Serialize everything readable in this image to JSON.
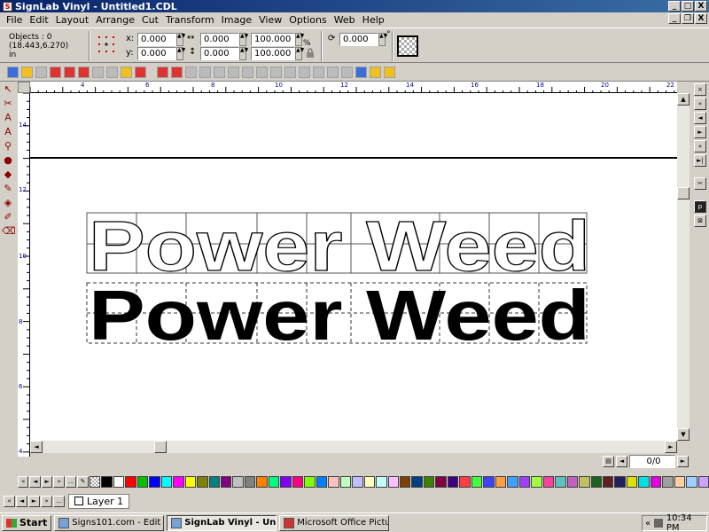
{
  "window": {
    "title": "SignLab Vinyl - Untitled1.CDL",
    "minimize": "_",
    "maximize": "□",
    "close": "X"
  },
  "menu": [
    "File",
    "Edit",
    "Layout",
    "Arrange",
    "Cut",
    "Transform",
    "Image",
    "View",
    "Options",
    "Web",
    "Help"
  ],
  "mdi_controls": {
    "minimize": "_",
    "restore": "❐",
    "close": "X"
  },
  "properties": {
    "objects_label": "Objects : 0",
    "cursor_pos": "(18.443,6.270)",
    "units": "in",
    "x_label": "x:",
    "y_label": "y:",
    "x_value": "0.000",
    "y_value": "0.000",
    "width_value": "0.000",
    "height_value": "0.000",
    "scale_x": "100.000",
    "scale_y": "100.000",
    "percent": "%",
    "rotation_value": "0.000",
    "degree": "°"
  },
  "ruler": {
    "top_labels": [
      "4",
      "6",
      "8",
      "10",
      "12",
      "14",
      "16",
      "18",
      "20",
      "22"
    ],
    "left_labels": [
      "14",
      "12",
      "10",
      "8",
      "6",
      "4"
    ]
  },
  "canvas": {
    "outline_text": "Power Weed",
    "filled_text": "Power Weed"
  },
  "page_nav": {
    "page_value": "0/0"
  },
  "palette": {
    "colors": [
      "#000000",
      "#ffffff",
      "#ff0000",
      "#00c000",
      "#0000ff",
      "#00ffff",
      "#ff00ff",
      "#ffff00",
      "#808000",
      "#008080",
      "#800080",
      "#c0c0c0",
      "#808080",
      "#ff8000",
      "#00ff80",
      "#8000ff",
      "#ff0080",
      "#80ff00",
      "#0080ff",
      "#ffc0c0",
      "#c0ffc0",
      "#c0c0ff",
      "#ffffc0",
      "#c0ffff",
      "#ffc0ff",
      "#804000",
      "#004080",
      "#408000",
      "#800040",
      "#400080",
      "#ff4040",
      "#40ff40",
      "#4040ff",
      "#ffa040",
      "#40a0ff",
      "#a040ff",
      "#a0ff40",
      "#ff40a0",
      "#60c0c0",
      "#c060c0",
      "#c0c060",
      "#206020",
      "#602020",
      "#202060",
      "#e0e000",
      "#00e0e0",
      "#e000e0",
      "#a0a0a0",
      "#ffd0a0",
      "#a0d0ff",
      "#d0a0ff"
    ]
  },
  "layers": {
    "active": "Layer 1"
  },
  "taskbar": {
    "start": "Start",
    "items": [
      "Signs101.com - Edit Post...",
      "SignLab Vinyl - Untitle...",
      "Microsoft Office Picture ..."
    ],
    "tray_chevron": "«",
    "clock": "10:34 PM"
  }
}
